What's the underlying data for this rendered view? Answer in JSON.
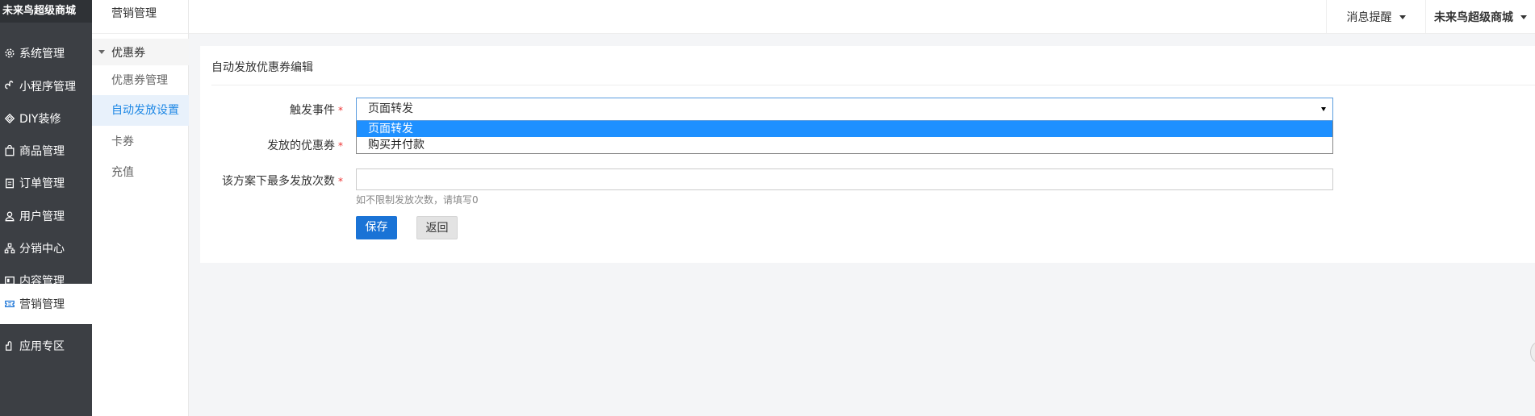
{
  "brand": "未来鸟超级商城",
  "sidebar": {
    "items": [
      {
        "label": "系统管理",
        "icon": "gear-icon"
      },
      {
        "label": "小程序管理",
        "icon": "link-icon"
      },
      {
        "label": "DIY装修",
        "icon": "diy-icon"
      },
      {
        "label": "商品管理",
        "icon": "bag-icon"
      },
      {
        "label": "订单管理",
        "icon": "clipboard-icon"
      },
      {
        "label": "用户管理",
        "icon": "user-icon"
      },
      {
        "label": "分销中心",
        "icon": "network-icon"
      },
      {
        "label": "内容管理",
        "icon": "content-icon"
      },
      {
        "label": "营销管理",
        "icon": "ticket-icon"
      },
      {
        "label": "应用专区",
        "icon": "app-icon"
      }
    ]
  },
  "subnav": {
    "title": "营销管理",
    "group": "优惠券",
    "items": [
      "优惠券管理",
      "自动发放设置",
      "卡券",
      "充值"
    ]
  },
  "topbar": {
    "messages": "消息提醒",
    "user": "未来鸟超级商城"
  },
  "form": {
    "title": "自动发放优惠券编辑",
    "trigger_label": "触发事件",
    "trigger_value": "页面转发",
    "trigger_options": [
      "页面转发",
      "购买并付款"
    ],
    "coupon_label": "发放的优惠券",
    "max_label": "该方案下最多发放次数",
    "max_value": "",
    "max_hint": "如不限制发放次数，请填写0",
    "required_mark": "*",
    "save_label": "保存",
    "back_label": "返回"
  },
  "colors": {
    "sidebar_bg": "#3c3f44",
    "accent": "#1a73d6",
    "dropdown_selected": "#1e90ff",
    "required": "#e33333"
  }
}
